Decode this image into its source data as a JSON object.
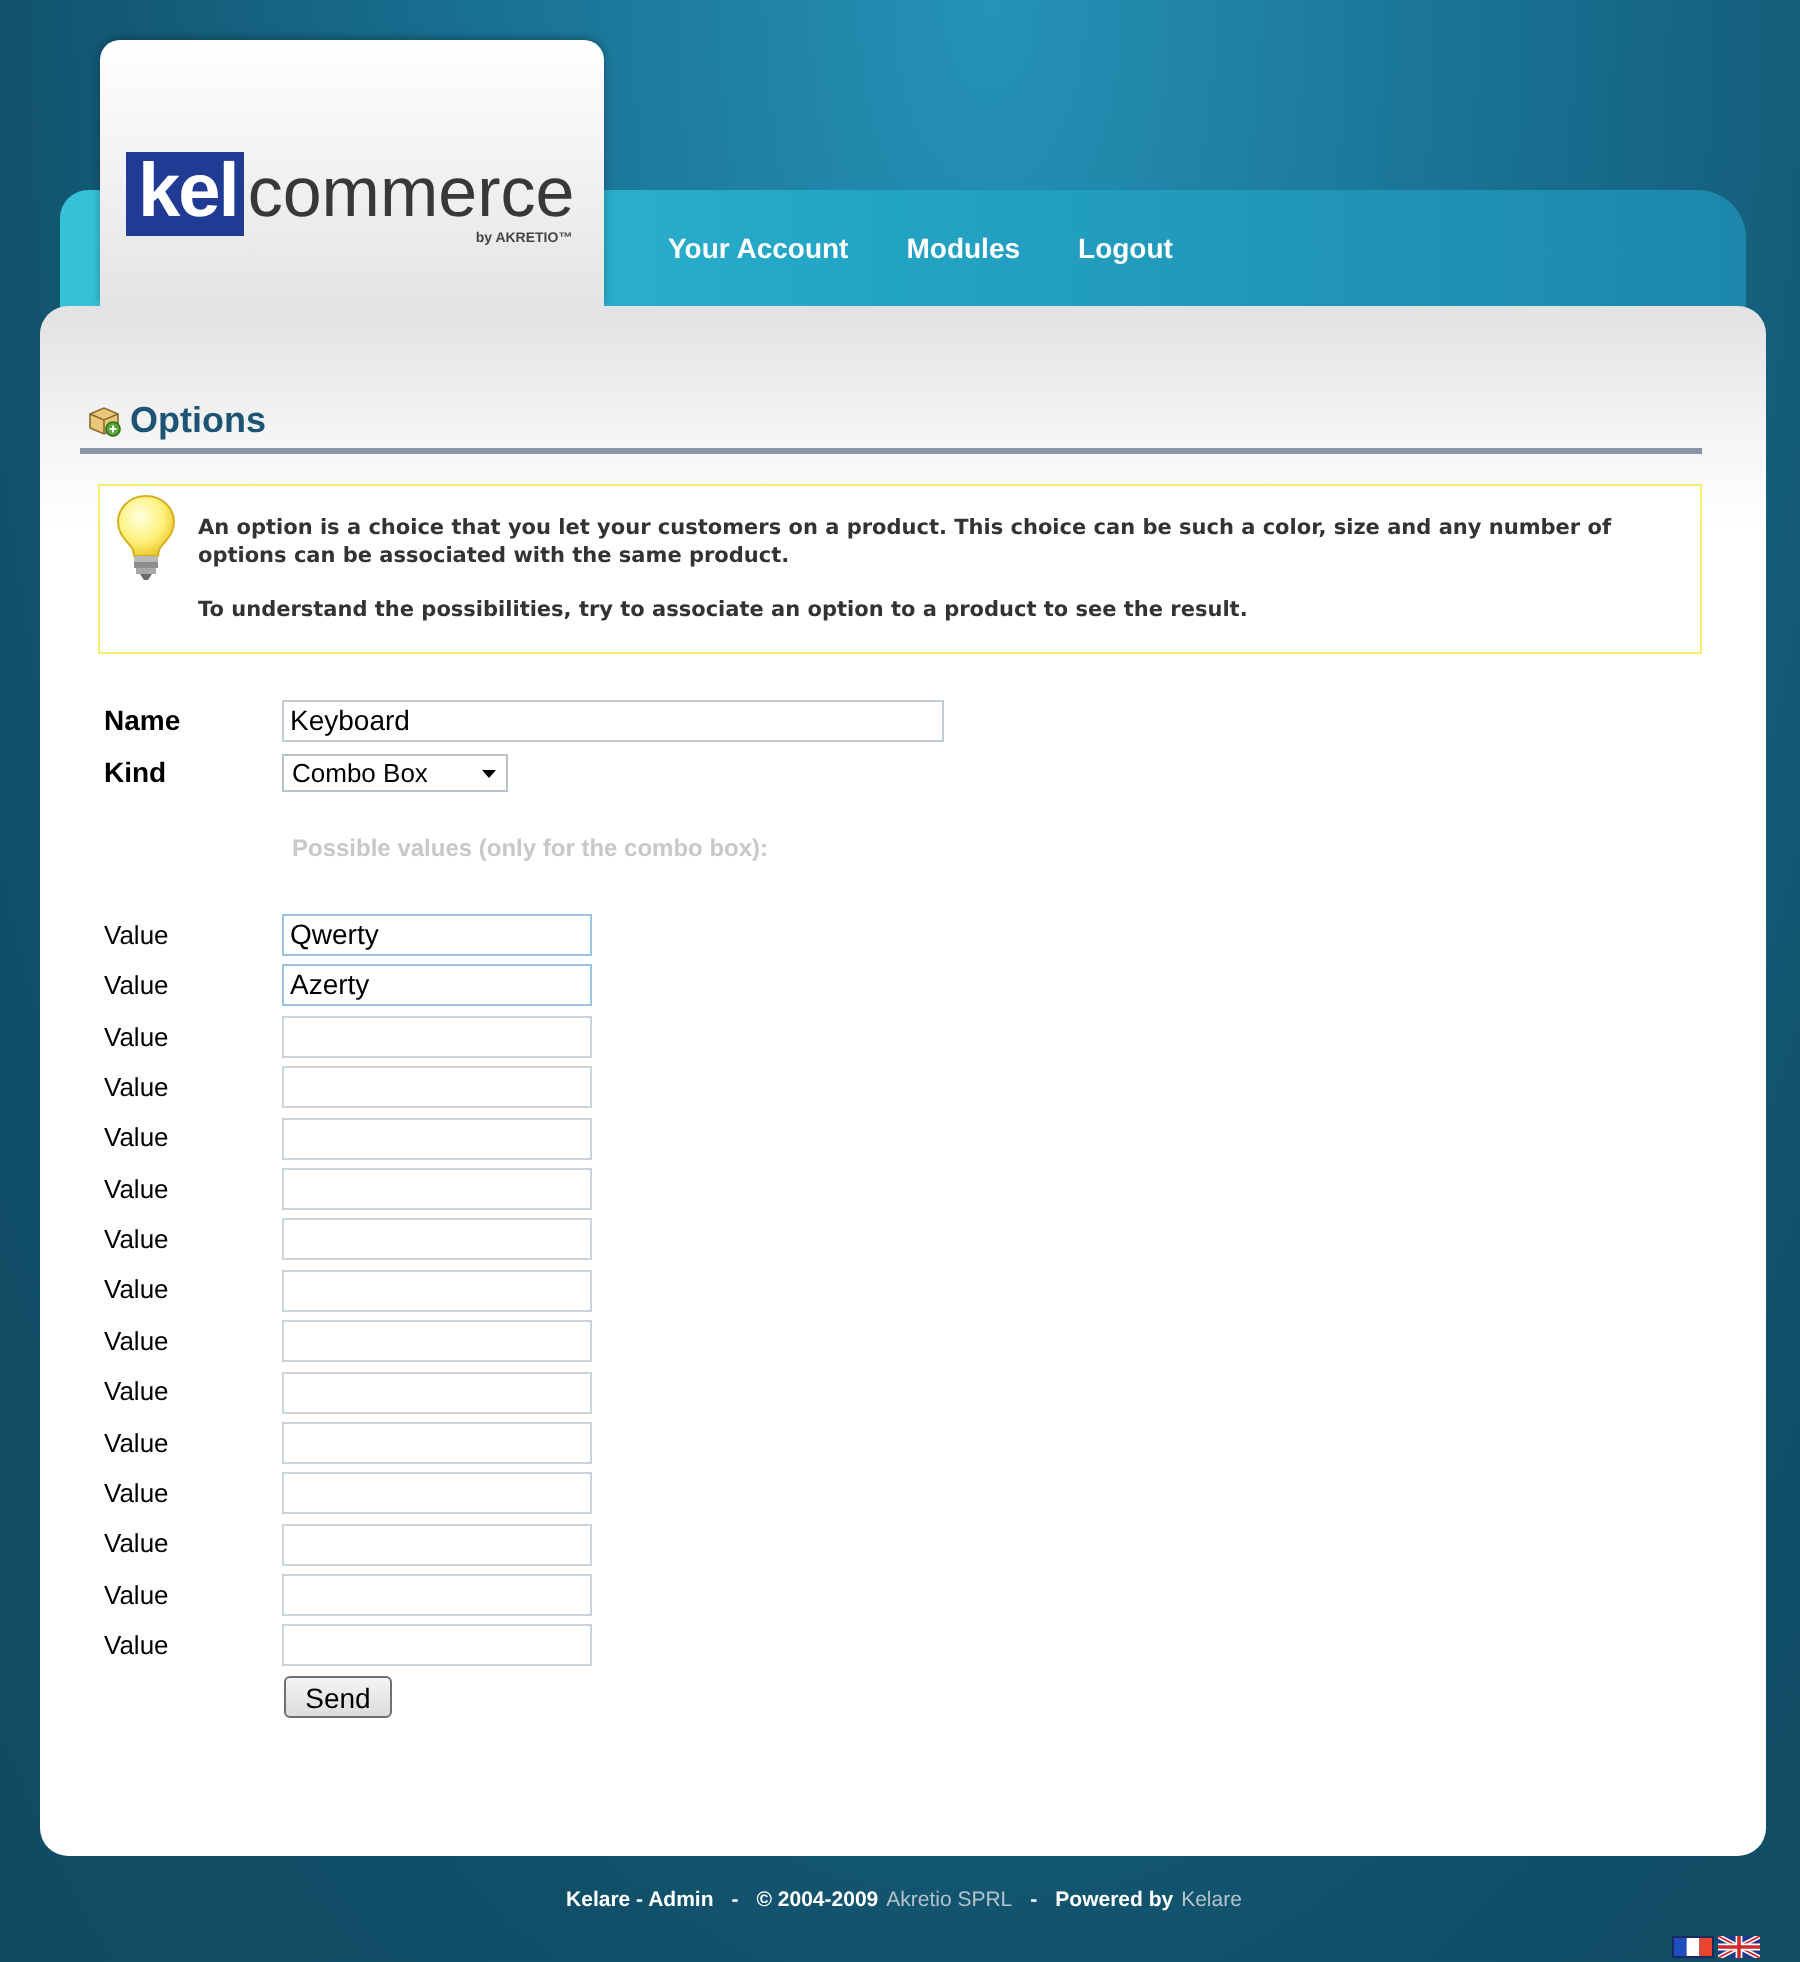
{
  "logo": {
    "boxed": "kel",
    "rest": "commerce",
    "byline": "by AKRETIO™"
  },
  "nav": [
    {
      "label": "Your Account"
    },
    {
      "label": "Modules"
    },
    {
      "label": "Logout"
    }
  ],
  "page": {
    "title": "Options"
  },
  "info": {
    "paragraphs": [
      "An option is a choice that you let your customers on a product. This choice can be such a color, size and any number of options can be associated with the same product.",
      "To understand the possibilities, try to associate an option to a product to see the result."
    ]
  },
  "form": {
    "fields": [
      {
        "kind": "text",
        "label": "Name",
        "value": "Keyboard"
      },
      {
        "kind": "select",
        "label": "Kind",
        "value": "Combo Box"
      }
    ],
    "values_hint": "Possible values (only for the combo box):",
    "values": [
      {
        "label": "Value",
        "value": "Qwerty"
      },
      {
        "label": "Value",
        "value": "Azerty"
      },
      {
        "label": "Value"
      },
      {
        "label": "Value"
      },
      {
        "label": "Value"
      },
      {
        "label": "Value"
      },
      {
        "label": "Value"
      },
      {
        "label": "Value"
      },
      {
        "label": "Value"
      },
      {
        "label": "Value"
      },
      {
        "label": "Value"
      },
      {
        "label": "Value"
      },
      {
        "label": "Value"
      },
      {
        "label": "Value"
      },
      {
        "label": "Value"
      }
    ],
    "submit": "Send"
  },
  "footer": {
    "segments": [
      {
        "kind": "strong",
        "text": "Kelare - Admin"
      },
      {
        "kind": "separator",
        "text": "-"
      },
      {
        "kind": "strong",
        "text": "© 2004-2009"
      },
      {
        "kind": "link",
        "text": "Akretio SPRL"
      },
      {
        "kind": "separator",
        "text": "-"
      },
      {
        "kind": "strong",
        "text": "Powered by"
      },
      {
        "kind": "link",
        "text": "Kelare"
      }
    ]
  }
}
